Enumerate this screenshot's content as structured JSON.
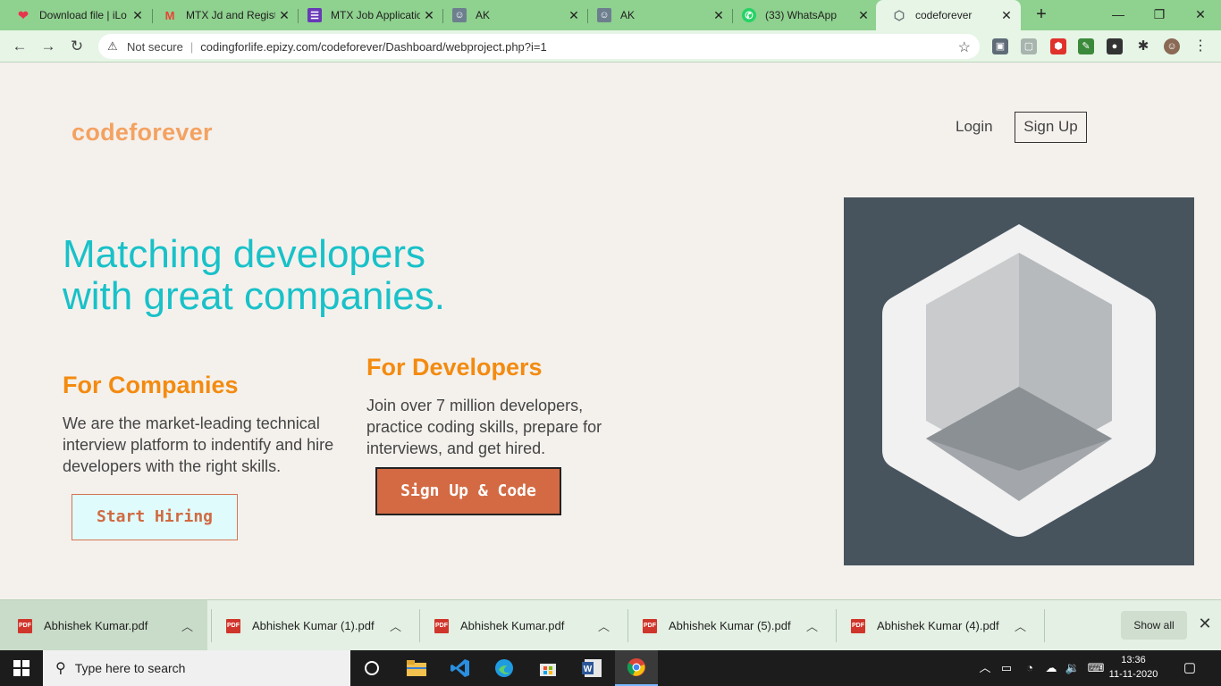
{
  "browser": {
    "tabs": [
      {
        "title": "Download file | iLo",
        "favicon": "heart-icon",
        "color": "#e8344e"
      },
      {
        "title": "MTX Jd and Regist",
        "favicon": "gmail-icon",
        "color": "#ea4335"
      },
      {
        "title": "MTX Job Applicatio",
        "favicon": "forms-icon",
        "color": "#673ab7"
      },
      {
        "title": "AK",
        "favicon": "avatar-icon",
        "color": "#6d7f8f"
      },
      {
        "title": "AK",
        "favicon": "avatar-icon",
        "color": "#6d7f8f"
      },
      {
        "title": "(33) WhatsApp",
        "favicon": "whatsapp-icon",
        "color": "#25d366"
      },
      {
        "title": "codeforever",
        "favicon": "site-icon",
        "color": "#8a8f94"
      }
    ],
    "active_tab": 6,
    "new_tab_label": "+",
    "window_controls": {
      "minimize": "—",
      "restore": "❐",
      "close": "✕"
    },
    "security_label": "Not secure",
    "url": "codingforlife.epizy.com/codeforever/Dashboard/webproject.php?i=1"
  },
  "page": {
    "logo": "codeforever",
    "nav": {
      "login": "Login",
      "signup": "Sign Up"
    },
    "hero_line1": "Matching developers",
    "hero_line2": "with great companies.",
    "companies": {
      "heading": "For Companies",
      "text": "We are the market-leading technical interview platform to indentify and hire developers with the right skills.",
      "button": "Start Hiring"
    },
    "developers": {
      "heading": "For Developers",
      "text": "Join over 7 million developers, practice coding skills, prepare for interviews, and get hired.",
      "button": "Sign Up & Code"
    },
    "colors": {
      "logo": "#f4a261",
      "hero": "#19c1c8",
      "heading": "#f38b10",
      "cta": "#d46a43",
      "art_bg": "#47545e"
    }
  },
  "downloads": {
    "items": [
      {
        "name": "Abhishek Kumar.pdf"
      },
      {
        "name": "Abhishek Kumar (1).pdf"
      },
      {
        "name": "Abhishek Kumar.pdf"
      },
      {
        "name": "Abhishek Kumar (5).pdf"
      },
      {
        "name": "Abhishek Kumar (4).pdf"
      }
    ],
    "file_badge": "PDF",
    "show_all": "Show all"
  },
  "taskbar": {
    "search_placeholder": "Type here to search",
    "time": "13:36",
    "date": "11-11-2020"
  }
}
